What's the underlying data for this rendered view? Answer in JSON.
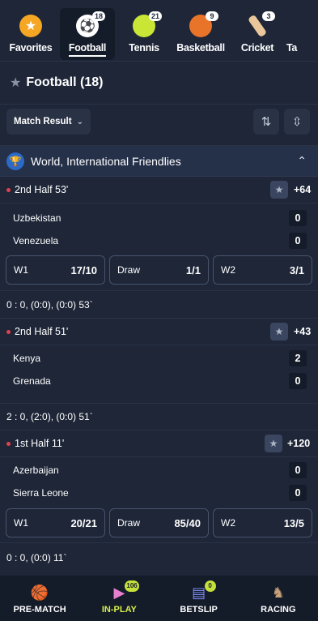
{
  "sports": [
    {
      "label": "Favorites",
      "icon": "star-icon"
    },
    {
      "label": "Football",
      "icon": "football-icon",
      "count": "18"
    },
    {
      "label": "Tennis",
      "icon": "tennis-icon",
      "count": "21"
    },
    {
      "label": "Basketball",
      "icon": "basketball-icon",
      "count": "9"
    },
    {
      "label": "Cricket",
      "icon": "cricket-icon",
      "count": "3"
    },
    {
      "label": "Ta"
    }
  ],
  "header": {
    "title": "Football (18)"
  },
  "filter": {
    "market_label": "Match Result"
  },
  "league": {
    "name": "World, International Friendlies"
  },
  "matches": [
    {
      "time": "2nd Half 53'",
      "more": "+64",
      "home": "Uzbekistan",
      "home_score": "0",
      "away": "Venezuela",
      "away_score": "0",
      "odds": [
        {
          "label": "W1",
          "value": "17/10"
        },
        {
          "label": "Draw",
          "value": "1/1"
        },
        {
          "label": "W2",
          "value": "3/1"
        }
      ],
      "summary": "0 : 0, (0:0), (0:0) 53`"
    },
    {
      "time": "2nd Half 51'",
      "more": "+43",
      "home": "Kenya",
      "home_score": "2",
      "away": "Grenada",
      "away_score": "0",
      "summary": "2 : 0, (2:0), (0:0) 51`"
    },
    {
      "time": "1st Half 11'",
      "more": "+120",
      "home": "Azerbaijan",
      "home_score": "0",
      "away": "Sierra Leone",
      "away_score": "0",
      "odds": [
        {
          "label": "W1",
          "value": "20/21"
        },
        {
          "label": "Draw",
          "value": "85/40"
        },
        {
          "label": "W2",
          "value": "13/5"
        }
      ],
      "summary": "0 : 0, (0:0) 11`"
    }
  ],
  "nav": [
    {
      "label": "PRE-MATCH"
    },
    {
      "label": "IN-PLAY",
      "badge": "106"
    },
    {
      "label": "BETSLIP",
      "badge": "0"
    },
    {
      "label": "RACING"
    }
  ],
  "colors": {
    "accent": "#d7f04a",
    "live": "#e0424f",
    "background": "#1e2638"
  }
}
